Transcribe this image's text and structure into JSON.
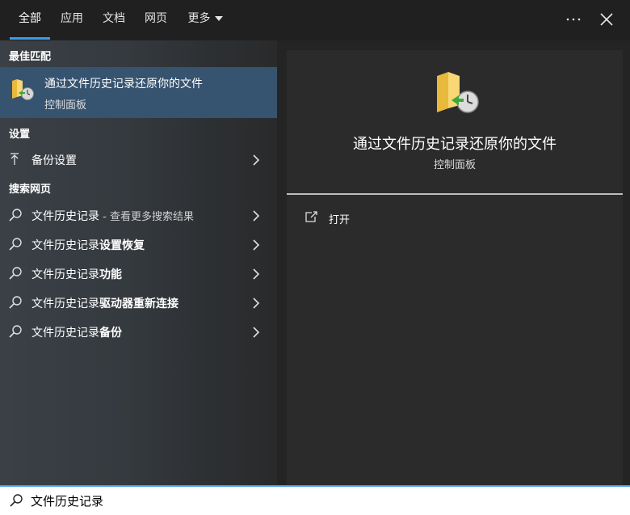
{
  "tabs": [
    {
      "label": "全部",
      "active": true
    },
    {
      "label": "应用"
    },
    {
      "label": "文档"
    },
    {
      "label": "网页"
    },
    {
      "label": "更多"
    }
  ],
  "top_actions": {
    "more_icon": "ellipsis-icon",
    "close_icon": "close-icon"
  },
  "sections": {
    "best_match": "最佳匹配",
    "settings": "设置",
    "web": "搜索网页"
  },
  "best_match": {
    "title": "通过文件历史记录还原你的文件",
    "subtitle": "控制面板",
    "icon": "file-history-folder-icon"
  },
  "settings_items": [
    {
      "label": "备份设置",
      "icon": "upload-arrow-icon"
    }
  ],
  "web_items": [
    {
      "text": "文件历史记录",
      "suffix": " - 查看更多搜索结果"
    },
    {
      "text": "文件历史记录",
      "bold": "设置恢复"
    },
    {
      "text": "文件历史记录",
      "bold": "功能"
    },
    {
      "text": "文件历史记录",
      "bold": "驱动器重新连接"
    },
    {
      "text": "文件历史记录",
      "bold": "备份"
    }
  ],
  "preview": {
    "title": "通过文件历史记录还原你的文件",
    "subtitle": "控制面板",
    "actions": [
      {
        "label": "打开",
        "icon": "open-external-icon"
      }
    ]
  },
  "search": {
    "value": "文件历史记录",
    "icon": "search-icon"
  },
  "colors": {
    "accent": "#3b9bea",
    "selected": "#36536f",
    "panel": "#2b2b2b"
  }
}
